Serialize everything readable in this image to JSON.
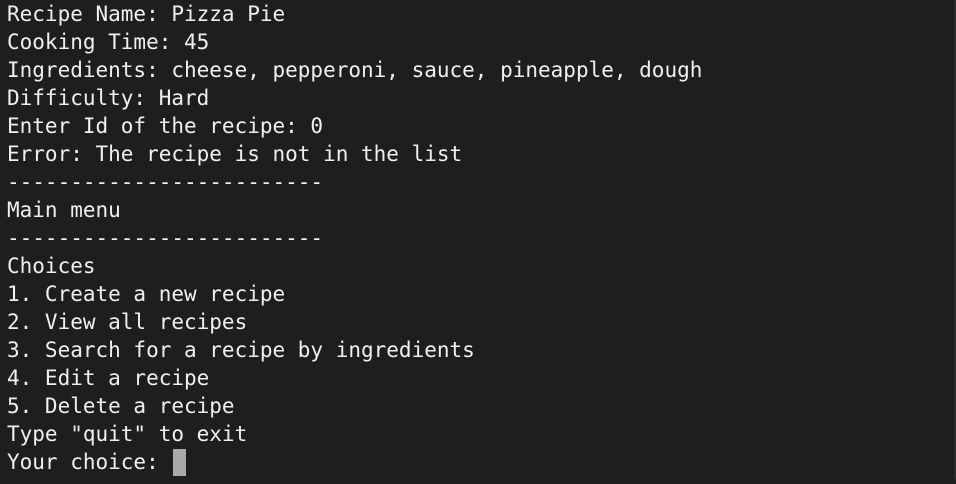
{
  "terminal": {
    "lines": [
      "Recipe Name: Pizza Pie",
      "Cooking Time: 45",
      "Ingredients: cheese, pepperoni, sauce, pineapple, dough",
      "Difficulty: Hard",
      "Enter Id of the recipe: 0",
      "Error: The recipe is not in the list",
      "-------------------------",
      "Main menu",
      "-------------------------",
      "Choices",
      "1. Create a new recipe",
      "2. View all recipes",
      "3. Search for a recipe by ingredients",
      "4. Edit a recipe",
      "5. Delete a recipe",
      "Type \"quit\" to exit"
    ],
    "prompt": "Your choice: ",
    "input_value": ""
  }
}
